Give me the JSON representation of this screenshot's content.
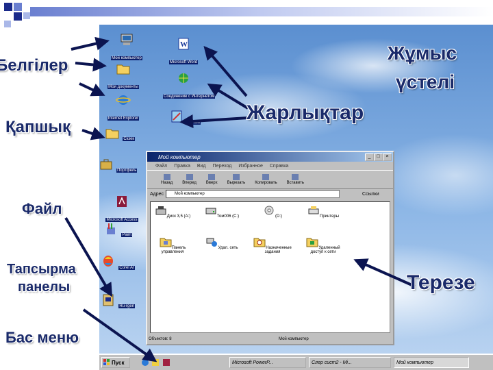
{
  "desktop_icons": [
    {
      "label": "Мой компьютер",
      "icon": "computer-icon"
    },
    {
      "label": "Мои документы",
      "icon": "folder-icon"
    },
    {
      "label": "Internet Explorer",
      "icon": "ie-icon"
    },
    {
      "label": "Скзек",
      "icon": "folder-icon"
    },
    {
      "label": "Портфель",
      "icon": "briefcase-icon"
    },
    {
      "label": "Microsoft Access",
      "icon": "access-icon"
    },
    {
      "label": "Paint",
      "icon": "paint-icon"
    },
    {
      "label": "Corel Ar",
      "icon": "balloon-icon"
    },
    {
      "label": "Ru-rgen",
      "icon": "file-icon"
    },
    {
      "label": "Microsoft Word",
      "icon": "word-icon"
    },
    {
      "label": "Соединение с Интернетом",
      "icon": "connection-icon"
    },
    {
      "label": "Фраза",
      "icon": "shortcut-icon"
    }
  ],
  "annotations": {
    "belgiler": "Белгілер",
    "kapshyk": "Қапшық",
    "fail": "Файл",
    "tapsyrma_1": "Тапсырма",
    "tapsyrma_2": "панелы",
    "bas_menu": "Бас меню",
    "zharlyktar": "Жарлықтар",
    "zhumys_1": "Жұмыс",
    "zhumys_2": "үстелі",
    "tereze": "Терезе"
  },
  "window": {
    "title": "Мой компьютер",
    "menu": [
      "Файл",
      "Правка",
      "Вид",
      "Переход",
      "Избранное",
      "Справка"
    ],
    "toolbar": [
      "Назад",
      "Вперед",
      "Вверх",
      "Вырезать",
      "Копировать",
      "Вставить"
    ],
    "address_label": "Адрес",
    "address_value": "Мой компьютер",
    "links_label": "Ссылки",
    "items": [
      {
        "label": "Диск 3,5 (A:)",
        "icon": "floppy-icon"
      },
      {
        "label": "Том006 (C:)",
        "icon": "drive-icon"
      },
      {
        "label": "(D:)",
        "icon": "cd-icon"
      },
      {
        "label": "Принтеры",
        "icon": "printer-icon"
      },
      {
        "label": "Панель управления",
        "icon": "control-panel-icon"
      },
      {
        "label": "Удал. сеть",
        "icon": "network-icon"
      },
      {
        "label": "Назначенные задания",
        "icon": "tasks-icon"
      },
      {
        "label": "Удаленный доступ к сети",
        "icon": "dialup-icon"
      }
    ],
    "status_left": "Объектов: 8",
    "status_right": "Мой компьютер"
  },
  "taskbar": {
    "start": "Пуск",
    "tasks": [
      "Microsoft PowerP...",
      "Слер сист2 - Mi...",
      "Мой компьютер"
    ]
  },
  "colors": {
    "title_dark": "#0a246a",
    "annot_text": "#1a2a6a",
    "arrow": "#0b1450"
  }
}
